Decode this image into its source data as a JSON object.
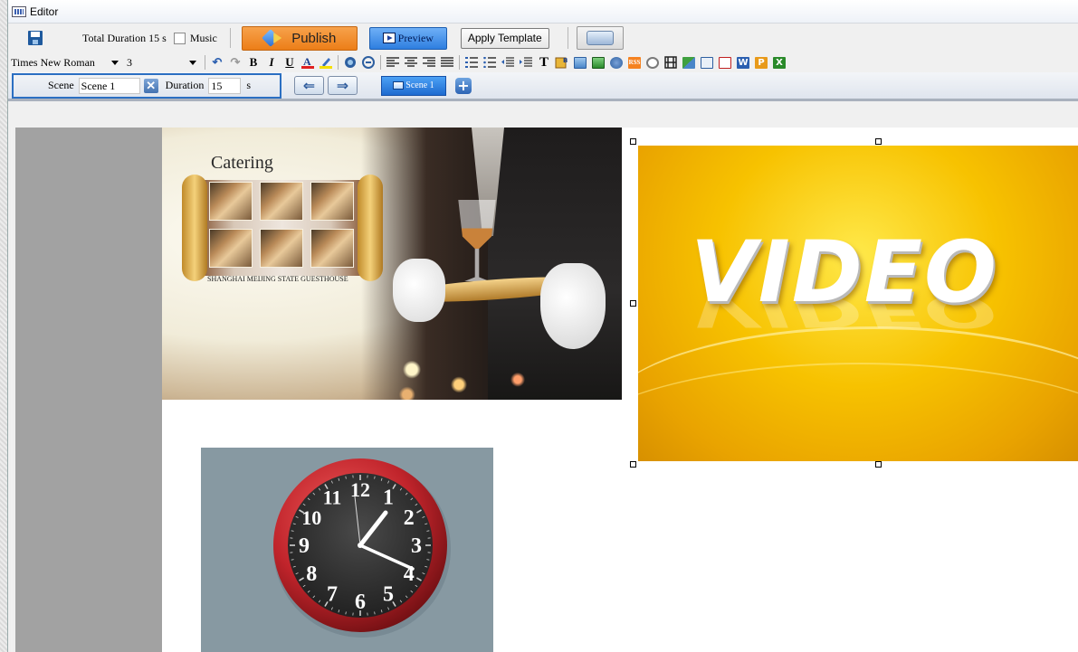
{
  "window": {
    "title": "Editor",
    "app_icon": "editor-app-icon"
  },
  "toolbar": {
    "save_icon": "save-icon",
    "total_duration": "Total Duration 15 s",
    "music_label": "Music",
    "music_checked": false,
    "publish_label": "Publish",
    "preview_label": "Preview",
    "apply_template_label": "Apply Template",
    "keyboard_icon": "keyboard-icon"
  },
  "format": {
    "font_name": "Times New Roman",
    "font_size": "3",
    "buttons": [
      {
        "name": "undo-icon",
        "glyph": "↶"
      },
      {
        "name": "redo-icon",
        "glyph": "↷"
      },
      {
        "name": "bold-button",
        "glyph": "B"
      },
      {
        "name": "italic-button",
        "glyph": "I"
      },
      {
        "name": "underline-button",
        "glyph": "U"
      }
    ]
  },
  "scene": {
    "scene_label": "Scene",
    "scene_value": "Scene 1",
    "duration_label": "Duration",
    "duration_value": "15",
    "unit": "s",
    "tab_label": "Scene 1"
  },
  "widgets": {
    "catering": {
      "title": "Catering",
      "caption": "SHANGHAI MEIJING STATE GUESTHOUSE"
    },
    "video": {
      "text": "VIDEO"
    },
    "clock": {
      "numbers": [
        "12",
        "1",
        "2",
        "3",
        "4",
        "5",
        "6",
        "7",
        "8",
        "9",
        "10",
        "11"
      ],
      "time_shown": "1:20"
    }
  },
  "colors": {
    "publish": "#ec7e18",
    "preview": "#2e7ee0",
    "scene_group_border": "#2b6fc2",
    "video_bg": "#f7c200",
    "clock_bg": "#8799a2",
    "clock_rim": "#c0242b"
  }
}
